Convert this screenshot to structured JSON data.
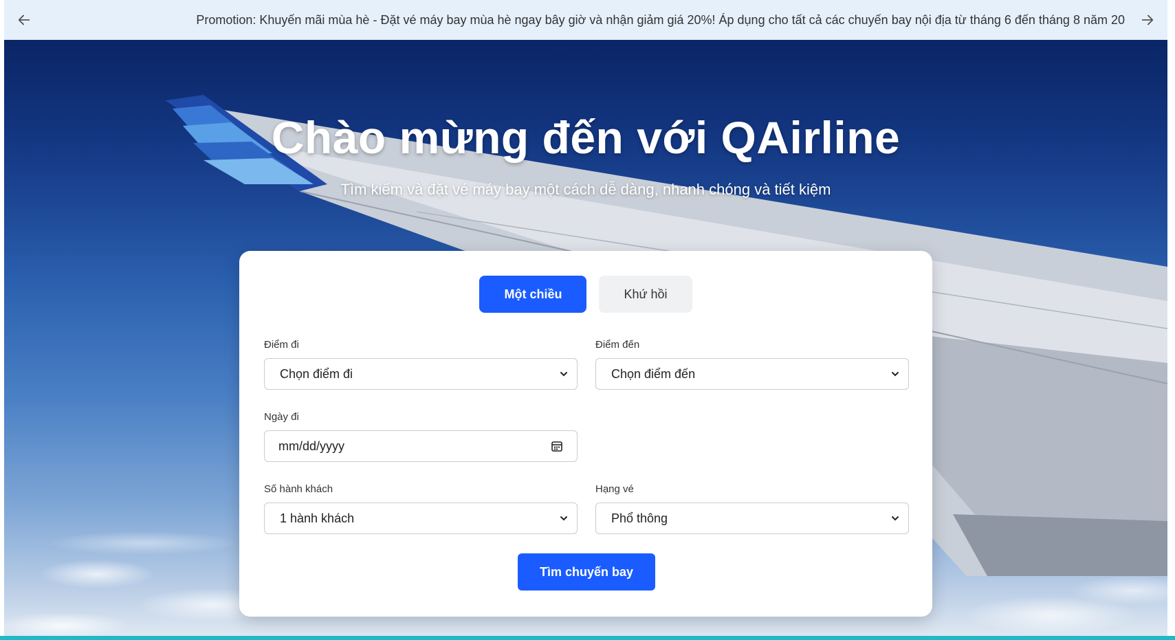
{
  "promo": {
    "text": "Promotion: Khuyến mãi mùa hè - Đặt vé máy bay mùa hè ngay bây giờ và nhận giảm giá 20%! Áp dụng cho tất cả các chuyến bay nội địa từ tháng 6 đến tháng 8 năm 20",
    "prev_icon": "arrow-left-icon",
    "next_icon": "arrow-right-icon"
  },
  "hero": {
    "title": "Chào mừng đến với QAirline",
    "subtitle": "Tìm kiếm và đặt vé máy bay một cách dễ dàng, nhanh chóng và tiết kiệm"
  },
  "search": {
    "tabs": [
      {
        "label": "Một chiều",
        "active": true
      },
      {
        "label": "Khứ hồi",
        "active": false
      }
    ],
    "origin": {
      "label": "Điểm đi",
      "value": "Chọn điểm đi"
    },
    "destination": {
      "label": "Điểm đến",
      "value": "Chọn điểm đến"
    },
    "departure_date": {
      "label": "Ngày đi",
      "placeholder": "mm/dd/yyyy",
      "icon": "calendar-icon"
    },
    "passengers": {
      "label": "Số hành khách",
      "value": "1 hành khách"
    },
    "ticket_class": {
      "label": "Hạng vé",
      "value": "Phổ thông"
    },
    "submit_label": "Tìm chuyến bay"
  },
  "colors": {
    "primary": "#1a5cff",
    "promo_bg": "#e6f0fb",
    "tab_inactive_bg": "#f0f1f3",
    "bottom_strip": "#22b8c8"
  }
}
